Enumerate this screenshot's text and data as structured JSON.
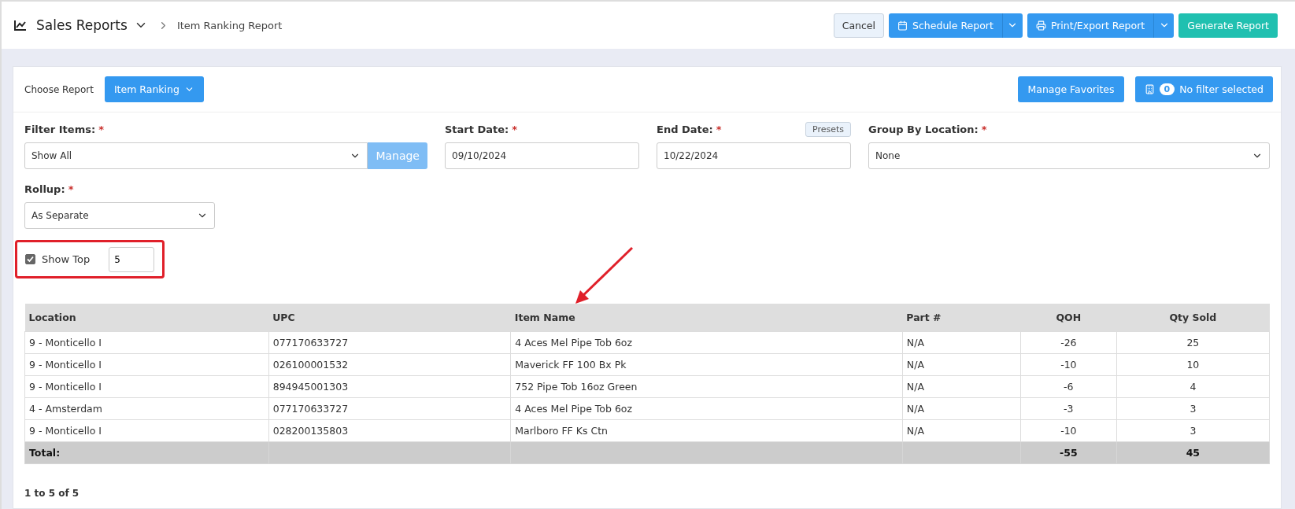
{
  "header": {
    "title": "Sales Reports",
    "breadcrumb": "Item Ranking Report",
    "buttons": [
      {
        "kind": "plain",
        "label": "Cancel"
      },
      {
        "kind": "split",
        "label": "Schedule Report"
      },
      {
        "kind": "split",
        "label": "Print/Export Report"
      },
      {
        "kind": "success",
        "label": "Generate Report"
      }
    ]
  },
  "report_bar": {
    "label": "Choose Report",
    "report": "Item Ranking",
    "favorites": "Manage Favorites",
    "filter_count": "0",
    "filter_text": "No filter selected"
  },
  "filters": {
    "filter_items": {
      "label": "Filter Items:",
      "value": "Show All",
      "button": "Manage"
    },
    "start_date": {
      "label": "Start Date:",
      "value": "09/10/2024"
    },
    "end_date": {
      "label": "End Date:",
      "value": "10/22/2024",
      "presets": "Presets"
    },
    "group_by": {
      "label": "Group By Location:",
      "value": "None"
    },
    "rollup": {
      "label": "Rollup:",
      "value": "As Separate"
    },
    "show_top": {
      "label": "Show Top",
      "checked": true,
      "value": "5",
      "highlighted": true
    },
    "required_mark": "*"
  },
  "table": {
    "columns": [
      "Location",
      "UPC",
      "Item Name",
      "Part #",
      "QOH",
      "Qty Sold"
    ],
    "rows": [
      [
        "9 - Monticello I",
        "077170633727",
        "4 Aces Mel Pipe Tob 6oz",
        "N/A",
        "-26",
        "25"
      ],
      [
        "9 - Monticello I",
        "026100001532",
        "Maverick FF 100 Bx Pk",
        "N/A",
        "-10",
        "10"
      ],
      [
        "9 - Monticello I",
        "894945001303",
        "752 Pipe Tob 16oz Green",
        "N/A",
        "-6",
        "4"
      ],
      [
        "4 - Amsterdam",
        "077170633727",
        "4 Aces Mel Pipe Tob 6oz",
        "N/A",
        "-3",
        "3"
      ],
      [
        "9 - Monticello I",
        "028200135803",
        "Marlboro FF Ks Ctn",
        "N/A",
        "-10",
        "3"
      ]
    ],
    "total": {
      "label": "Total:",
      "qoh": "-55",
      "qty_sold": "45"
    }
  },
  "pagination": "1 to 5 of 5"
}
